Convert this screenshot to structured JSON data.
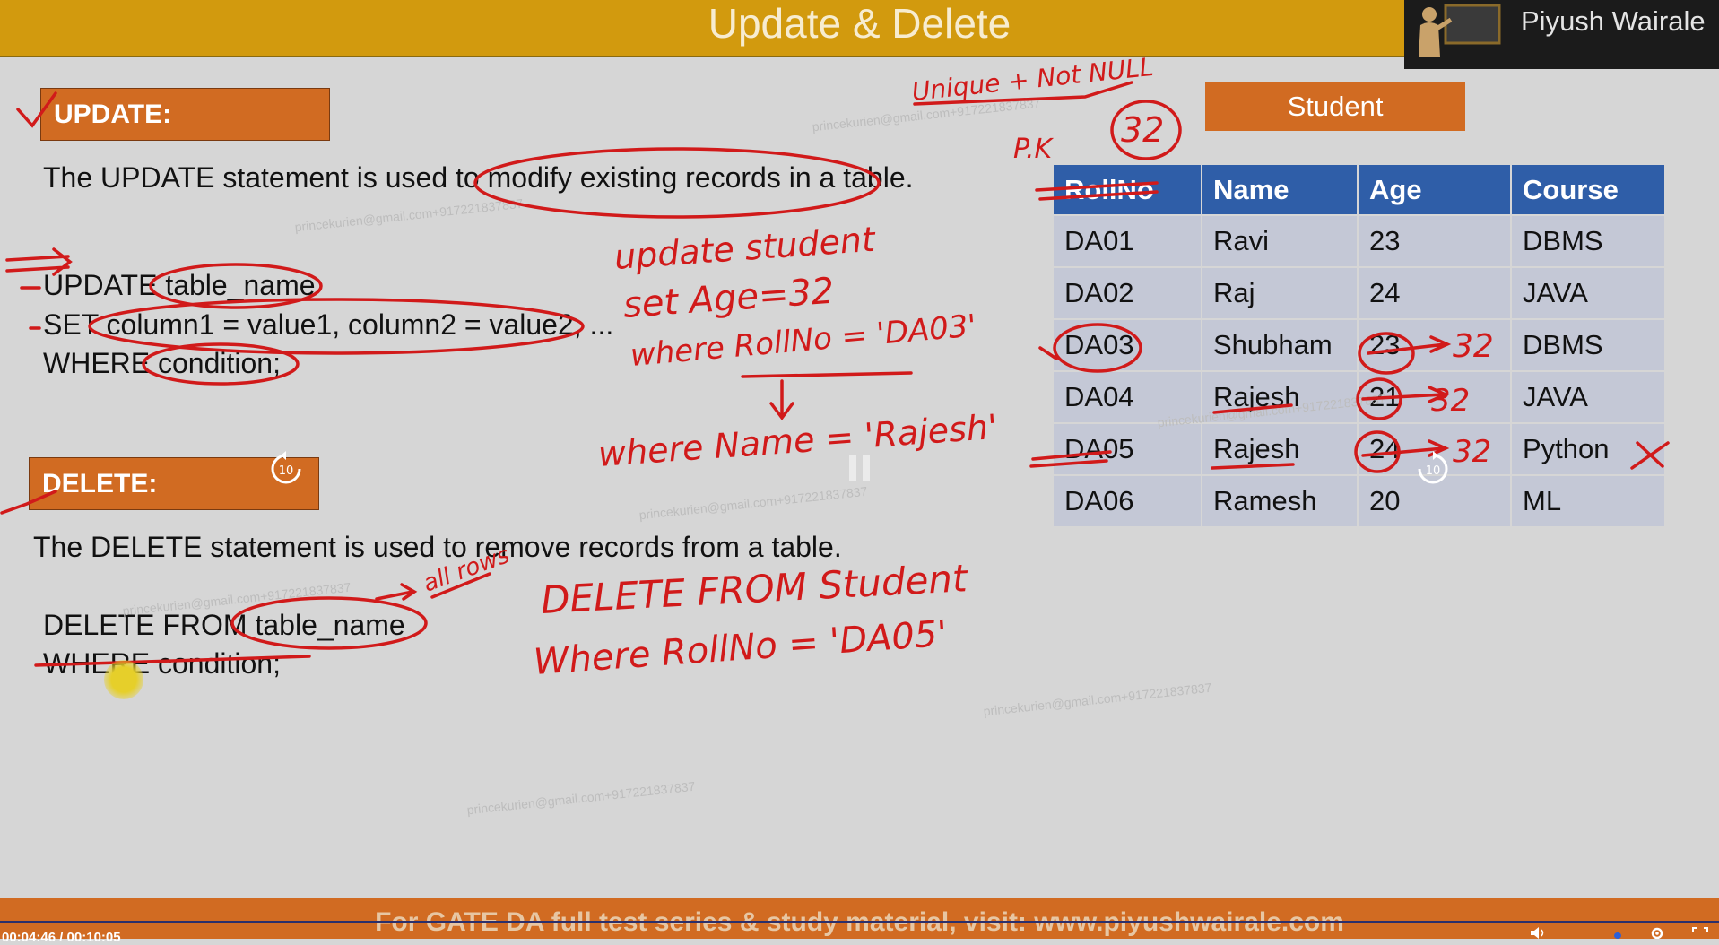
{
  "header": {
    "title": "Update & Delete",
    "presenter": "Piyush Wairale"
  },
  "update": {
    "section_label": "UPDATE:",
    "description": "The UPDATE statement is used to modify existing records in a table.",
    "syntax_line1": "UPDATE table_name",
    "syntax_line2": "SET column1 = value1, column2 = value2, ...",
    "syntax_line3": "WHERE condition;"
  },
  "delete": {
    "section_label": "DELETE:",
    "description": "The DELETE statement is used to remove records from a table.",
    "syntax_line1": "DELETE FROM table_name",
    "syntax_line2": "WHERE condition;"
  },
  "student_table": {
    "title": "Student",
    "columns": [
      "RollNo",
      "Name",
      "Age",
      "Course"
    ],
    "rows": [
      [
        "DA01",
        "Ravi",
        "23",
        "DBMS"
      ],
      [
        "DA02",
        "Raj",
        "24",
        "JAVA"
      ],
      [
        "DA03",
        "Shubham",
        "23",
        "DBMS"
      ],
      [
        "DA04",
        "Rajesh",
        "21",
        "JAVA"
      ],
      [
        "DA05",
        "Rajesh",
        "24",
        "Python"
      ],
      [
        "DA06",
        "Ramesh",
        "20",
        "ML"
      ]
    ]
  },
  "annotations": {
    "unique_not_null": "Unique + Not NULL",
    "pk": "P.K",
    "circled_value": "32",
    "update_query_1": "update student",
    "update_query_2": "set Age=32",
    "update_query_3": "where RollNo = 'DA03'",
    "update_query_4": "where Name = 'Rajesh'",
    "age_new_1": "32",
    "age_new_2": "32",
    "age_new_3": "32",
    "all_rows": "all rows",
    "delete_query_1": "DELETE FROM Student",
    "delete_query_2": "Where RollNo = 'DA05'"
  },
  "watermark": {
    "text": "princekurien@gmail.com+917221837837"
  },
  "player": {
    "skip_back_label": "10",
    "skip_forward_label": "10",
    "time": "00:04:46 / 00:10:05"
  },
  "footer": {
    "text": "For GATE DA full test series & study material, visit: www.piyushwairale.com"
  },
  "colors": {
    "title_bar": "#d29a0e",
    "section_orange": "#d16b22",
    "table_header": "#2f5ea8",
    "table_cell": "#c4c8d6",
    "ink_red": "#d11a1a",
    "background": "#d6d6d6"
  },
  "icons": {
    "presenter": "teacher-at-board-icon",
    "skip_back": "replay-10-icon",
    "skip_forward": "forward-10-icon",
    "pause": "pause-icon",
    "volume": "volume-icon",
    "settings": "gear-icon"
  }
}
